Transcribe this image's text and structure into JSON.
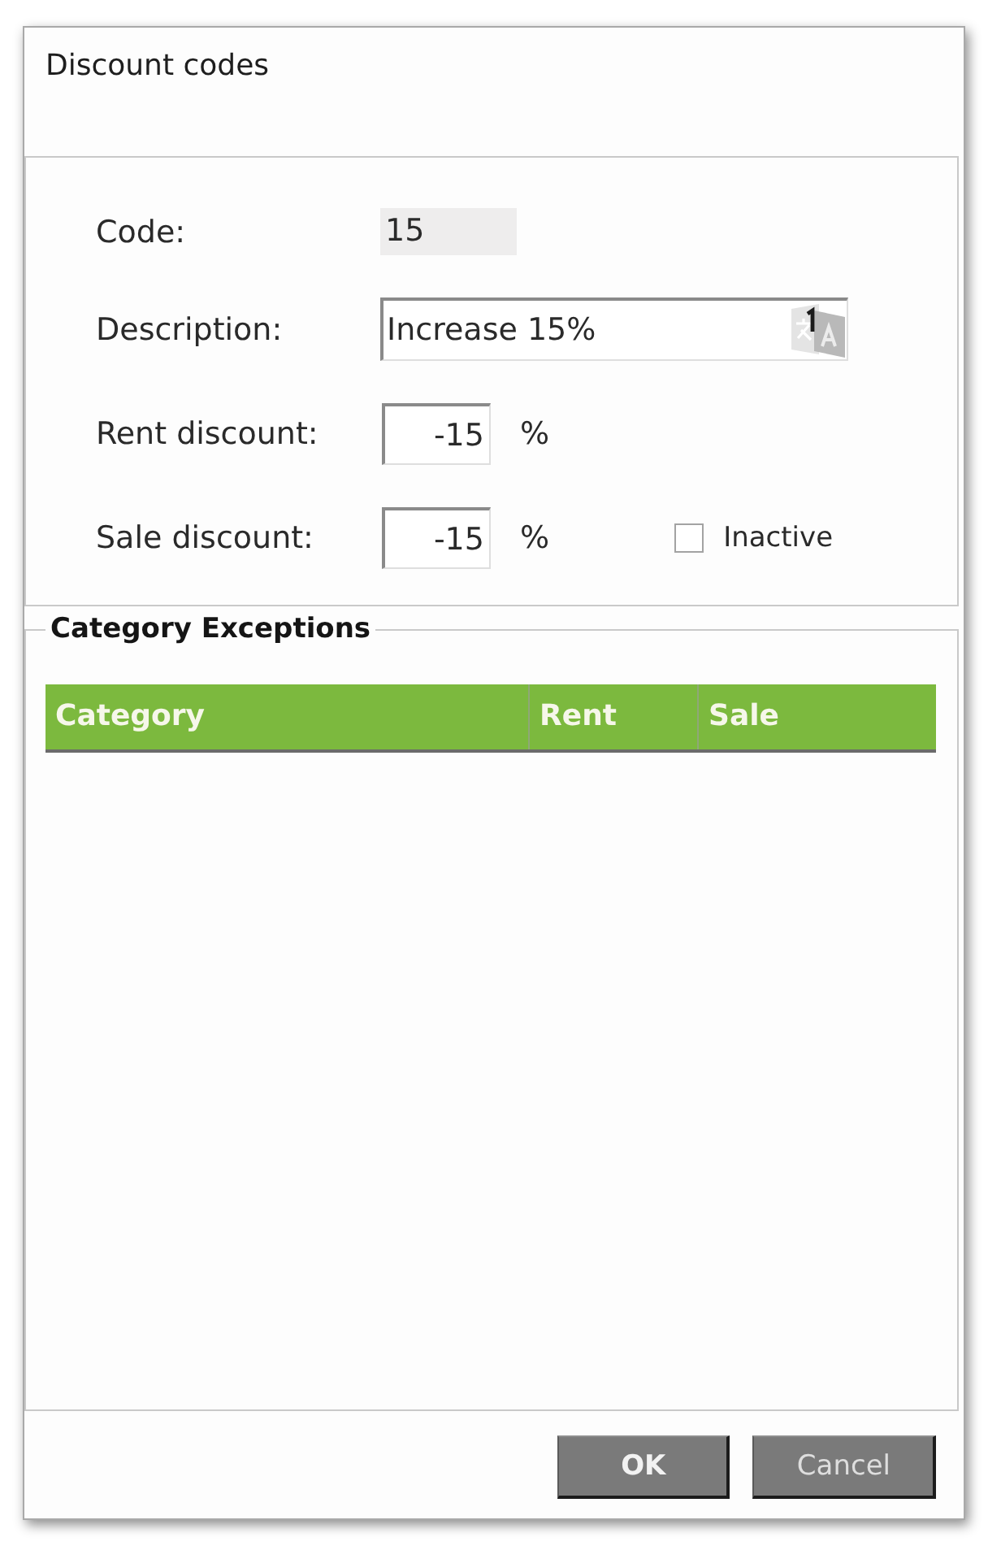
{
  "window": {
    "title": "Discount codes"
  },
  "form": {
    "fields": [
      {
        "kind": "readonly",
        "label": "Code:",
        "value": "15"
      },
      {
        "kind": "text",
        "label": "Description:",
        "value": "Increase 15%"
      },
      {
        "kind": "percent",
        "label": "Rent discount:",
        "value": "-15",
        "unit": "%"
      },
      {
        "kind": "percent",
        "label": "Sale discount:",
        "value": "-15",
        "unit": "%",
        "checkbox": {
          "label": "Inactive",
          "checked": false
        }
      }
    ]
  },
  "category_exceptions": {
    "title": "Category Exceptions",
    "columns": [
      "Category",
      "Rent",
      "Sale"
    ]
  },
  "buttons": [
    {
      "label": "OK",
      "default": true
    },
    {
      "label": "Cancel",
      "default": false
    }
  ]
}
